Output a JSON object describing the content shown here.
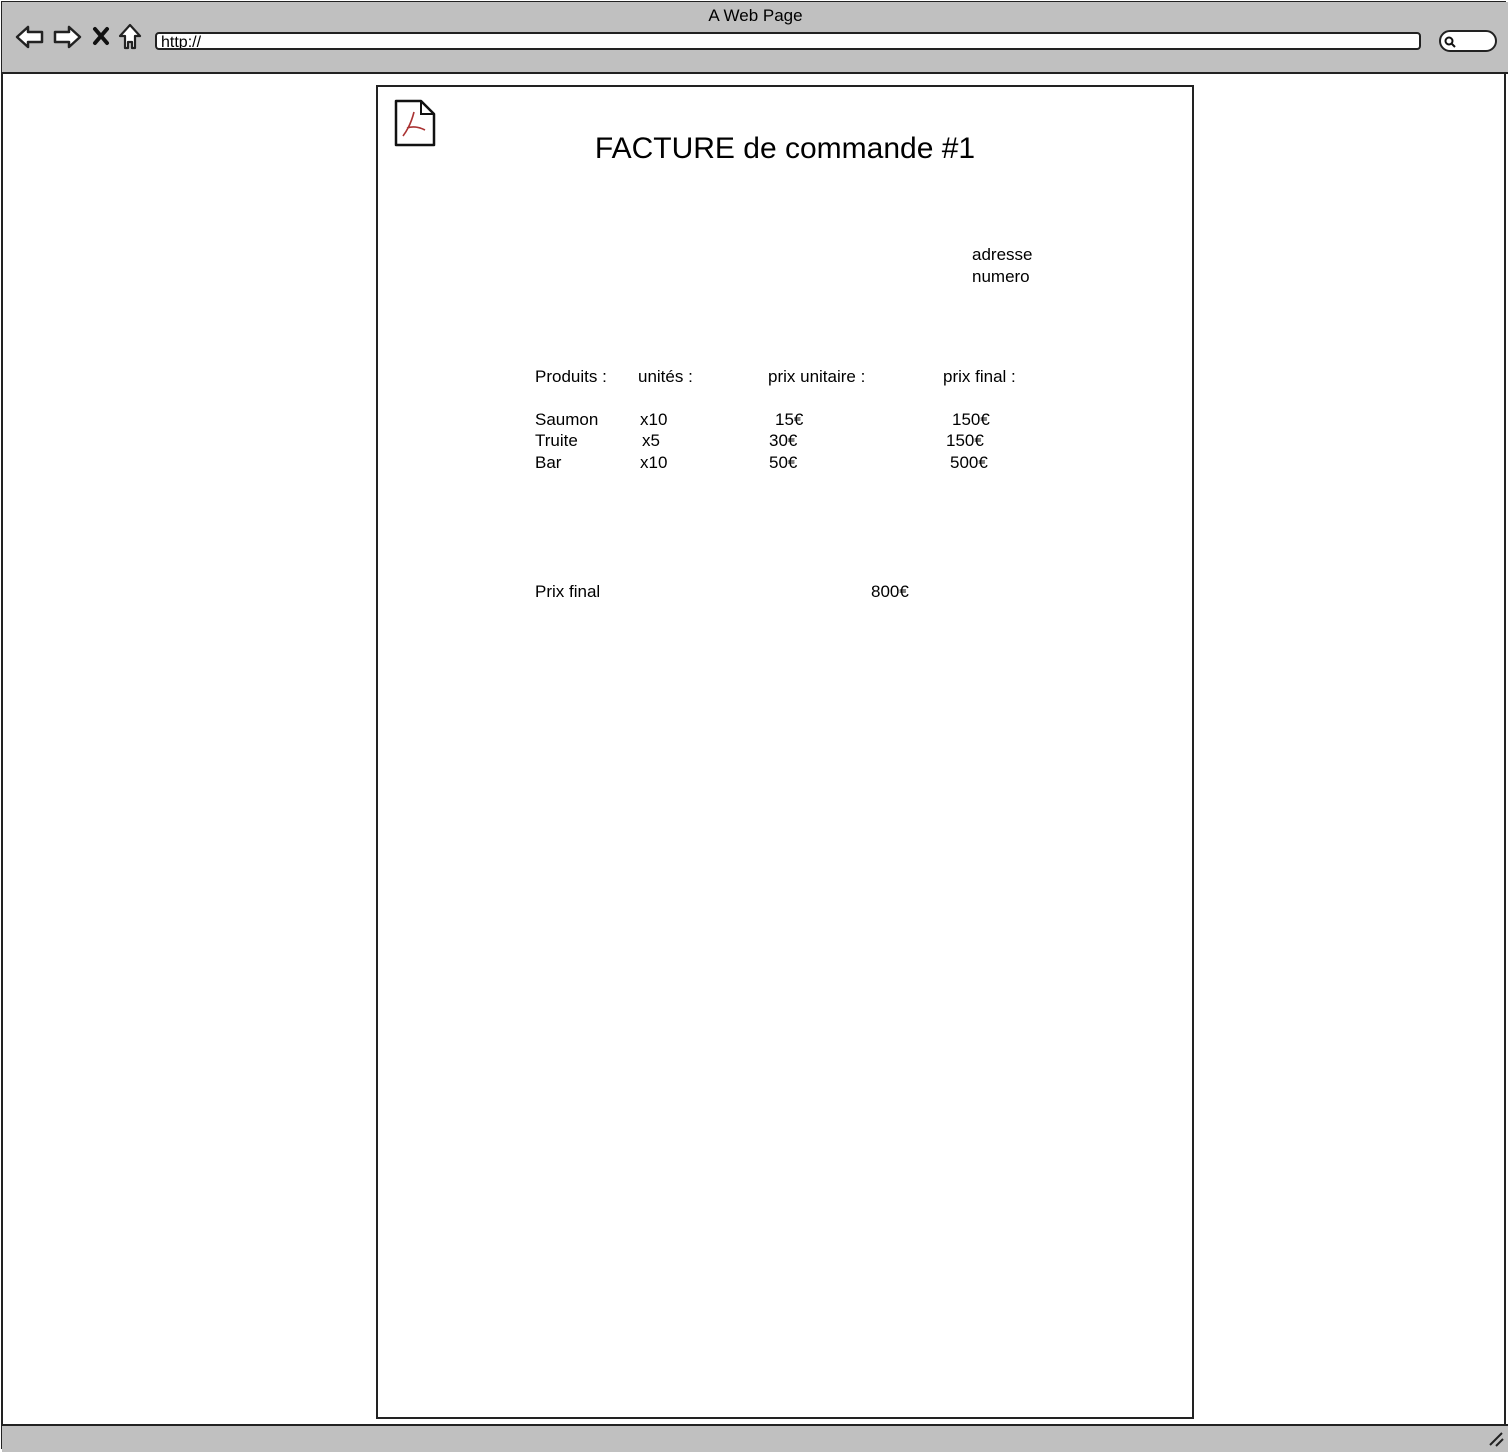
{
  "browser": {
    "title": "A Web Page",
    "url": "http://"
  },
  "document": {
    "title": "FACTURE de commande #1",
    "address_lines": [
      "adresse",
      "numero"
    ],
    "columns": [
      "Produits :",
      "unités :",
      "prix unitaire :",
      "prix final :"
    ],
    "rows": [
      {
        "product": "Saumon",
        "units": "x10",
        "unit_price": "15€",
        "final_price": "150€"
      },
      {
        "product": "Truite",
        "units": "x5",
        "unit_price": "30€",
        "final_price": "150€"
      },
      {
        "product": "Bar",
        "units": "x10",
        "unit_price": "50€",
        "final_price": "500€"
      }
    ],
    "total_label": "Prix final",
    "total_value": "800€"
  }
}
